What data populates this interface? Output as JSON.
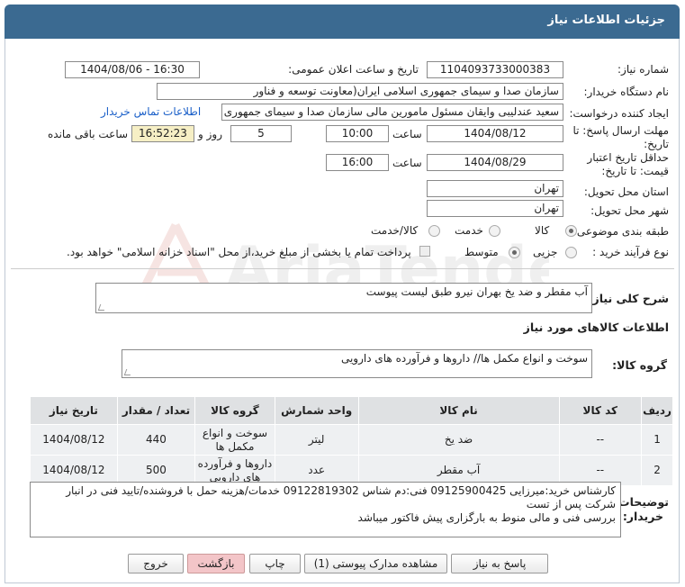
{
  "header": {
    "title": "جزئیات اطلاعات نیاز"
  },
  "fields": {
    "need_number_label": "شماره نیاز:",
    "need_number": "1104093733000383",
    "announce_label": "تاریخ و ساعت اعلان عمومی:",
    "announce_value": "1404/08/06 - 16:30",
    "buyer_org_label": "نام دستگاه خریدار:",
    "buyer_org": "سازمان صدا و سیمای جمهوری اسلامی ایران(معاونت توسعه و فناور",
    "creator_label": "ایجاد کننده درخواست:",
    "creator": "سعید عندلیبی وایقان مسئول مامورین مالی  سازمان صدا و سیمای جمهوری اس",
    "contact_link": "اطلاعات تماس خریدار",
    "deadline_label_1": "مهلت ارسال پاسخ: تا",
    "deadline_label_2": "تاریخ:",
    "deadline_date": "1404/08/12",
    "time_word": "ساعت",
    "deadline_time": "10:00",
    "days_value": "5",
    "days_word": "روز و",
    "remaining_time": "16:52:23",
    "remaining_label": "ساعت باقی مانده",
    "validity_label_1": "حداقل تاریخ اعتبار",
    "validity_label_2": "قیمت: تا تاریخ:",
    "validity_date": "1404/08/29",
    "validity_time": "16:00",
    "province_label": "استان محل تحویل:",
    "province": "تهران",
    "city_label": "شهر محل تحویل:",
    "city": "تهران",
    "category_label": "طبقه بندی موضوعی:",
    "category_options": [
      "کالا",
      "خدمت",
      "کالا/خدمت"
    ],
    "category_selected": "کالا",
    "process_label": "نوع فرآیند خرید :",
    "process_options": [
      "جزیی",
      "متوسط"
    ],
    "process_selected": "متوسط",
    "payment_note": "پرداخت تمام یا بخشی از مبلغ خرید،از محل \"اسناد خزانه اسلامی\" خواهد بود."
  },
  "summary": {
    "label": "شرح کلی نیاز:",
    "text": "آب مقطر و ضد یخ بهران نیرو طبق لیست پیوست"
  },
  "goods": {
    "section_title": "اطلاعات کالاهای مورد نیاز",
    "group_label": "گروه کالا:",
    "group_text": "سوخت و انواع مکمل ها// داروها و فرآورده های دارویی",
    "columns": [
      "ردیف",
      "کد کالا",
      "نام کالا",
      "واحد شمارش",
      "گروه کالا",
      "تعداد / مقدار",
      "تاریخ نیاز"
    ],
    "rows": [
      {
        "index": "1",
        "code": "--",
        "name": "ضد یخ",
        "unit": "لیتر",
        "group": "سوخت و انواع مکمل ها",
        "qty": "440",
        "date": "1404/08/12"
      },
      {
        "index": "2",
        "code": "--",
        "name": "آب مقطر",
        "unit": "عدد",
        "group": "داروها و فرآورده های دارویی",
        "qty": "500",
        "date": "1404/08/12"
      }
    ]
  },
  "buyer_notes": {
    "label_1": "توضیحات",
    "label_2": "خریدار:",
    "line1": "کارشناس خرید:میرزایی 09125900425  فنی:دم شناس 09122819302 خدمات/هزینه حمل با فروشنده/تایید فنی در انبار",
    "line2": "شرکت پس از تست",
    "line3": "بررسی فنی و مالی منوط به بارگزاری پیش فاکتور میباشد"
  },
  "buttons": {
    "reply": "پاسخ به نیاز",
    "attachments": "مشاهده مدارک پیوستی (1)",
    "print": "چاپ",
    "back": "بازگشت",
    "exit": "خروج"
  },
  "watermark": {
    "text": "AriaTender.neT"
  },
  "colors": {
    "header_bg": "#3b6a91",
    "link": "#1a5fc8",
    "remaining_bg": "#f6efc5",
    "back_button": "#f3c5c8"
  }
}
